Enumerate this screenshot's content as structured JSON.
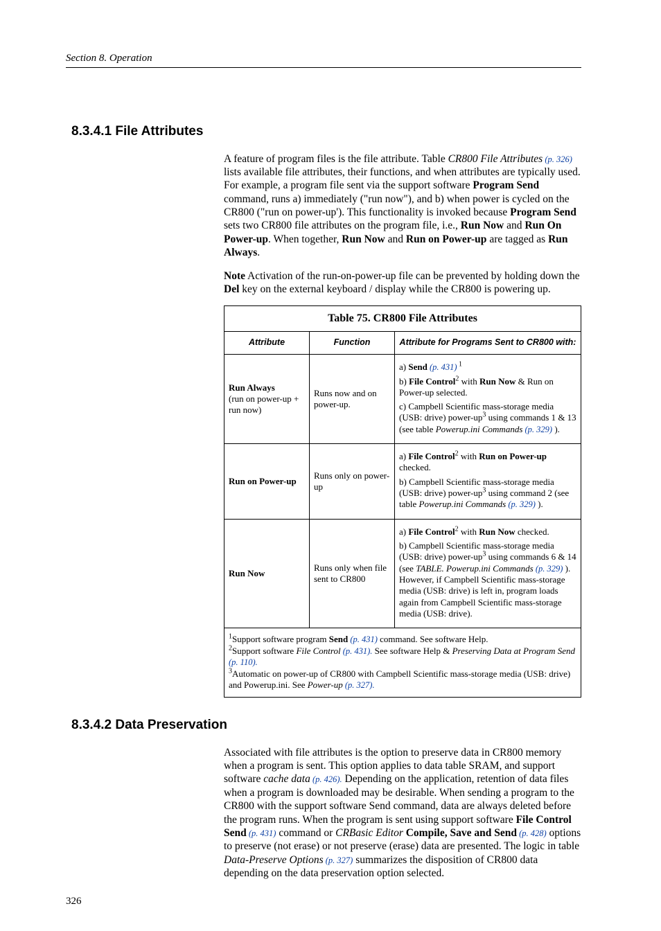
{
  "running_head": "Section 8.  Operation",
  "page_number": "326",
  "s1_heading": "8.3.4.1 File Attributes",
  "p1_a": "A feature of program files is the file attribute. Table ",
  "p1_a_ital": "CR800 File Attributes",
  "p1_a_link": " (p. 326)",
  "p1_b": " lists available file attributes, their functions, and when attributes are typically used. For example, a program file sent via the support software ",
  "p1_b_bold": "Program Send",
  "p1_c": " command, runs a) immediately (\"run now\"), and b) when power is cycled on the CR800 (\"run on power-up'). This functionality is invoked because ",
  "p1_c_bold": "Program Send",
  "p1_d": " sets two CR800 file attributes on the program file, i.e., ",
  "p1_d_bold1": "Run Now",
  "p1_d_and": " and ",
  "p1_d_bold2": "Run On Power-up",
  "p1_e": ". When together, ",
  "p1_e_bold1": "Run Now",
  "p1_e_and": " and ",
  "p1_e_bold2": "Run on Power-up",
  "p1_e_tag": " are tagged as ",
  "p1_e_bold3": "Run Always",
  "p1_e_end": ".",
  "note_bold": "Note",
  "note_a": "  Activation of the run-on-power-up file can be prevented by holding down the ",
  "note_bold2": "Del",
  "note_b": " key on the external keyboard / display while the CR800 is powering up.",
  "table_caption": "Table 75.  CR800 File Attributes",
  "th1": "Attribute",
  "th2": "Function",
  "th3": "Attribute for Programs Sent to CR800 with:",
  "r1c1_bold": "Run Always",
  "r1c1_sub": "(run on power-up + run now)",
  "r1c2": "Runs now and on power-up.",
  "r1c3_a1": "a) ",
  "r1c3_a1_bold": "Send",
  "r1c3_a1_link": " (p. 431)",
  "r1c3_b1": "b) ",
  "r1c3_b1_bold": "File Control",
  "r1c3_b1_mid": " with ",
  "r1c3_b1_bold2": "Run Now",
  "r1c3_b1_tail": " & Run on Power-up selected.",
  "r1c3_c1": "c) Campbell Scientific mass-storage media (USB: drive) power-up",
  "r1c3_c1_mid": " using commands 1 & 13 (see table ",
  "r1c3_c1_ital": "Powerup.ini Commands",
  "r1c3_c1_link": " (p. 329)",
  "r1c3_c1_end": " ).",
  "r2c1_bold": "Run on Power-up",
  "r2c2": "Runs only on power-up",
  "r2c3_a": "a) ",
  "r2c3_a_bold": "File Control",
  "r2c3_a_mid": " with ",
  "r2c3_a_bold2": "Run on Power-up",
  "r2c3_a_tail": " checked.",
  "r2c3_b": "b) Campbell Scientific mass-storage media (USB: drive) power-up",
  "r2c3_b_mid": " using command 2 (see table ",
  "r2c3_b_ital": "Powerup.ini Commands",
  "r2c3_b_link": " (p. 329)",
  "r2c3_b_end": " ).",
  "r3c1_bold": "Run Now",
  "r3c2": "Runs only when file sent to CR800",
  "r3c3_a": "a) ",
  "r3c3_a_bold": "File Control",
  "r3c3_a_mid": " with ",
  "r3c3_a_bold2": "Run Now",
  "r3c3_a_tail": " checked.",
  "r3c3_b": "b) Campbell Scientific mass-storage media (USB: drive) power-up",
  "r3c3_b_mid": " using commands 6 & 14 (see ",
  "r3c3_b_ital": "TABLE. Powerup.ini Commands",
  "r3c3_b_link": " (p. 329)",
  "r3c3_b_end": " ). However, if Campbell Scientific mass-storage media (USB: drive) is left in, program loads again from Campbell Scientific mass-storage media (USB: drive).",
  "fn1_a": "Support software program ",
  "fn1_bold": "Send",
  "fn1_link": " (p. 431)",
  "fn1_b": " command. See software Help.",
  "fn2_a": "Support software ",
  "fn2_ital": "File Control",
  "fn2_link1": " (p. 431).",
  "fn2_b": " See software Help & ",
  "fn2_ital2": "Preserving Data at Program Send",
  "fn2_link2": " (p. 110).",
  "fn3_a": "Automatic on power-up of CR800 with Campbell Scientific mass-storage media (USB: drive) and Powerup.ini. See ",
  "fn3_ital": "Power-up",
  "fn3_link": " (p. 327).",
  "s2_heading": "8.3.4.2 Data Preservation",
  "p2_a": "Associated with file attributes is the option to preserve data in CR800 memory when a program is sent. This option applies to data table SRAM, and support software ",
  "p2_a_ital": "cache data",
  "p2_a_link": " (p. 426).",
  "p2_b": " Depending on the application, retention of data files when a program is downloaded may be desirable. When sending a program to the CR800 with the support software Send command, data are always deleted before the program runs. When the program is sent using support software ",
  "p2_b_bold": "File Control Send",
  "p2_b_link": " (p. 431)",
  "p2_c": " command or ",
  "p2_c_ital": "CRBasic Editor",
  "p2_c_sp": " ",
  "p2_c_bold": "Compile, Save and Send",
  "p2_c_link": " (p. 428)",
  "p2_d": " options to preserve (not erase) or not preserve (erase) data are presented. The logic in table ",
  "p2_d_ital": "Data-Preserve Options",
  "p2_d_link": " (p. 327)",
  "p2_e": " summarizes the disposition of CR800 data depending on the data preservation option selected."
}
